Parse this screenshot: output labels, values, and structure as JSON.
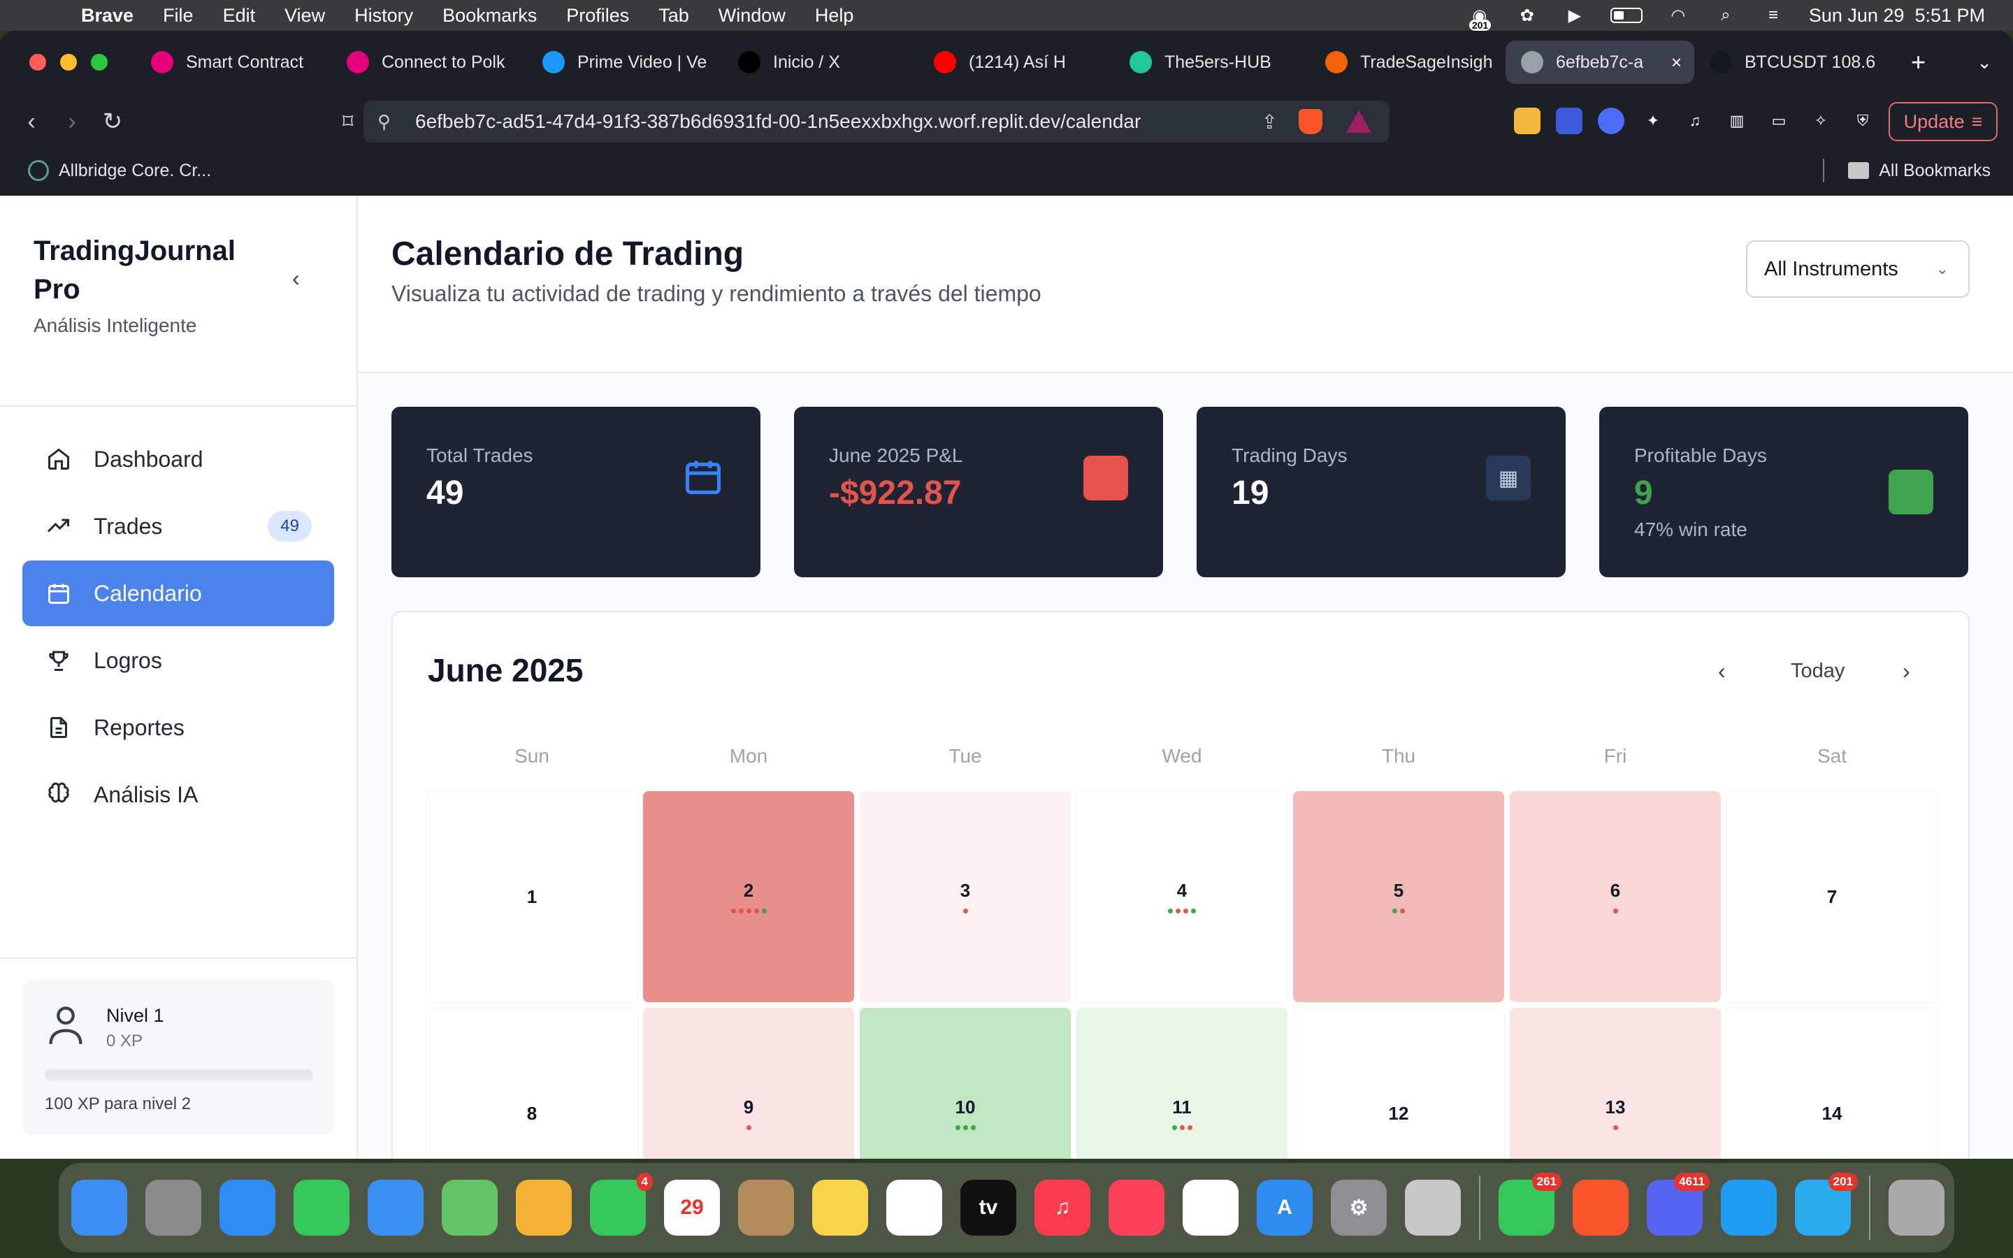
{
  "menubar": {
    "app": "Brave",
    "items": [
      "File",
      "Edit",
      "View",
      "History",
      "Bookmarks",
      "Profiles",
      "Tab",
      "Window",
      "Help"
    ],
    "notification_badge": "201",
    "clock": "Sun Jun 29  5:51 PM"
  },
  "browser": {
    "tabs": [
      {
        "title": "Smart Contract",
        "icon": "polkadot-icon",
        "color": "#e6007a"
      },
      {
        "title": "Connect to Polk",
        "icon": "polkadot-icon",
        "color": "#e6007a"
      },
      {
        "title": "Prime Video | Ve",
        "icon": "prime-video-icon",
        "color": "#1a98ff"
      },
      {
        "title": "Inicio / X",
        "icon": "x-icon",
        "color": "#000000"
      },
      {
        "title": "(1214) Así H",
        "icon": "youtube-icon",
        "color": "#ff0000"
      },
      {
        "title": "The5ers-HUB",
        "icon": "the5ers-icon",
        "color": "#20c997"
      },
      {
        "title": "TradeSageInsigh",
        "icon": "replit-icon",
        "color": "#f26207"
      },
      {
        "title": "6efbeb7c-a",
        "icon": "globe-icon",
        "color": "#9aa0a6",
        "active": true
      },
      {
        "title": "BTCUSDT 108.6",
        "icon": "tradingview-icon",
        "color": "#131722"
      }
    ],
    "url": "6efbeb7c-ad51-47d4-91f3-387b6d6931fd-00-1n5eexxbxhgx.worf.replit.dev/calendar",
    "update_label": "Update",
    "bookmark_item": "Allbridge Core. Cr...",
    "all_bookmarks": "All Bookmarks"
  },
  "sidebar": {
    "brand": "TradingJournal Pro",
    "subtitle": "Análisis Inteligente",
    "nav": [
      {
        "label": "Dashboard",
        "icon": "home-icon"
      },
      {
        "label": "Trades",
        "icon": "trending-up-icon",
        "badge": "49"
      },
      {
        "label": "Calendario",
        "icon": "calendar-icon",
        "active": true
      },
      {
        "label": "Logros",
        "icon": "trophy-icon"
      },
      {
        "label": "Reportes",
        "icon": "document-icon"
      },
      {
        "label": "Análisis IA",
        "icon": "brain-icon"
      }
    ],
    "level": {
      "title": "Nivel 1",
      "xp": "0 XP",
      "progress": 0,
      "next": "100 XP para nivel 2"
    }
  },
  "header": {
    "title": "Calendario de Trading",
    "subtitle": "Visualiza tu actividad de trading y rendimiento a través del tiempo",
    "instrument_filter": "All Instruments"
  },
  "stats": [
    {
      "label": "Total Trades",
      "value": "49",
      "icon": "calendar-icon",
      "icon_color": "#3b82f6"
    },
    {
      "label": "June 2025 P&L",
      "value": "-$922.87",
      "tone": "neg",
      "icon": "red-square",
      "icon_color": "#e5534b"
    },
    {
      "label": "Trading Days",
      "value": "19",
      "icon": "calendar-emoji-icon",
      "icon_color": "#2a3b5a"
    },
    {
      "label": "Profitable Days",
      "value": "9",
      "tone": "pos",
      "note": "47% win rate",
      "icon": "green-square",
      "icon_color": "#3fa54d"
    }
  ],
  "calendar": {
    "title": "June 2025",
    "today_label": "Today",
    "weekdays": [
      "Sun",
      "Mon",
      "Tue",
      "Wed",
      "Thu",
      "Fri",
      "Sat"
    ],
    "days": [
      {
        "day": "1",
        "bg": "#ffffff",
        "dots": []
      },
      {
        "day": "2",
        "bg": "#e88e8b",
        "dots": [
          "#e5534b",
          "#e5534b",
          "#e5534b",
          "#e5534b",
          "#3fa54d"
        ]
      },
      {
        "day": "3",
        "bg": "#fdf2f2",
        "dots": [
          "#e5534b"
        ]
      },
      {
        "day": "4",
        "bg": "#ffffff",
        "dots": [
          "#3fa54d",
          "#e5534b",
          "#e5534b",
          "#3fa54d"
        ]
      },
      {
        "day": "5",
        "bg": "#f2bab7",
        "dots": [
          "#3fa54d",
          "#e5534b"
        ]
      },
      {
        "day": "6",
        "bg": "#f9d8d7",
        "dots": [
          "#e5534b"
        ]
      },
      {
        "day": "7",
        "bg": "#ffffff",
        "dots": []
      },
      {
        "day": "8",
        "bg": "#ffffff",
        "dots": []
      },
      {
        "day": "9",
        "bg": "#fae4e3",
        "dots": [
          "#e5534b"
        ]
      },
      {
        "day": "10",
        "bg": "#c0e6c2",
        "dots": [
          "#3fa54d",
          "#3fa54d",
          "#3fa54d"
        ]
      },
      {
        "day": "11",
        "bg": "#e8f6e8",
        "dots": [
          "#3fa54d",
          "#e5534b",
          "#e5534b"
        ]
      },
      {
        "day": "12",
        "bg": "#ffffff",
        "dots": []
      },
      {
        "day": "13",
        "bg": "#fae4e3",
        "dots": [
          "#e5534b"
        ]
      },
      {
        "day": "14",
        "bg": "#ffffff",
        "dots": []
      }
    ]
  },
  "dock": [
    {
      "name": "finder",
      "color": "#3d8ef0",
      "label": ""
    },
    {
      "name": "launchpad",
      "color": "#8b8b8b",
      "label": ""
    },
    {
      "name": "safari",
      "color": "#2f8cf3",
      "label": ""
    },
    {
      "name": "messages",
      "color": "#35c759",
      "label": ""
    },
    {
      "name": "mail",
      "color": "#3b8ff0",
      "label": ""
    },
    {
      "name": "maps",
      "color": "#63c466",
      "label": ""
    },
    {
      "name": "photos",
      "color": "#f5b335",
      "label": ""
    },
    {
      "name": "facetime",
      "color": "#35c759",
      "label": "",
      "badge": "4"
    },
    {
      "name": "calendar",
      "color": "#ffffff",
      "label": "29"
    },
    {
      "name": "contacts",
      "color": "#b38a5a",
      "label": ""
    },
    {
      "name": "notes",
      "color": "#f7d54a",
      "label": ""
    },
    {
      "name": "freeform",
      "color": "#ffffff",
      "label": ""
    },
    {
      "name": "apple-tv",
      "color": "#111111",
      "label": "tv"
    },
    {
      "name": "music",
      "color": "#fb3c4e",
      "label": "♫"
    },
    {
      "name": "news",
      "color": "#f94058",
      "label": ""
    },
    {
      "name": "reminders",
      "color": "#ffffff",
      "label": ""
    },
    {
      "name": "app-store",
      "color": "#2e8cf0",
      "label": "A"
    },
    {
      "name": "system-settings",
      "color": "#8e8e93",
      "label": "⚙"
    },
    {
      "name": "iphone-mirroring",
      "color": "#c8c8c8",
      "label": ""
    },
    {
      "name": "whatsapp",
      "color": "#35c759",
      "label": "",
      "badge": "261"
    },
    {
      "name": "brave",
      "color": "#fb542b",
      "label": ""
    },
    {
      "name": "discord",
      "color": "#5865f2",
      "label": "",
      "badge": "4611"
    },
    {
      "name": "vscode",
      "color": "#1f9cf0",
      "label": ""
    },
    {
      "name": "telegram",
      "color": "#2aabee",
      "label": "",
      "badge": "201"
    },
    {
      "name": "trash",
      "color": "#a9a9a9",
      "label": ""
    }
  ]
}
